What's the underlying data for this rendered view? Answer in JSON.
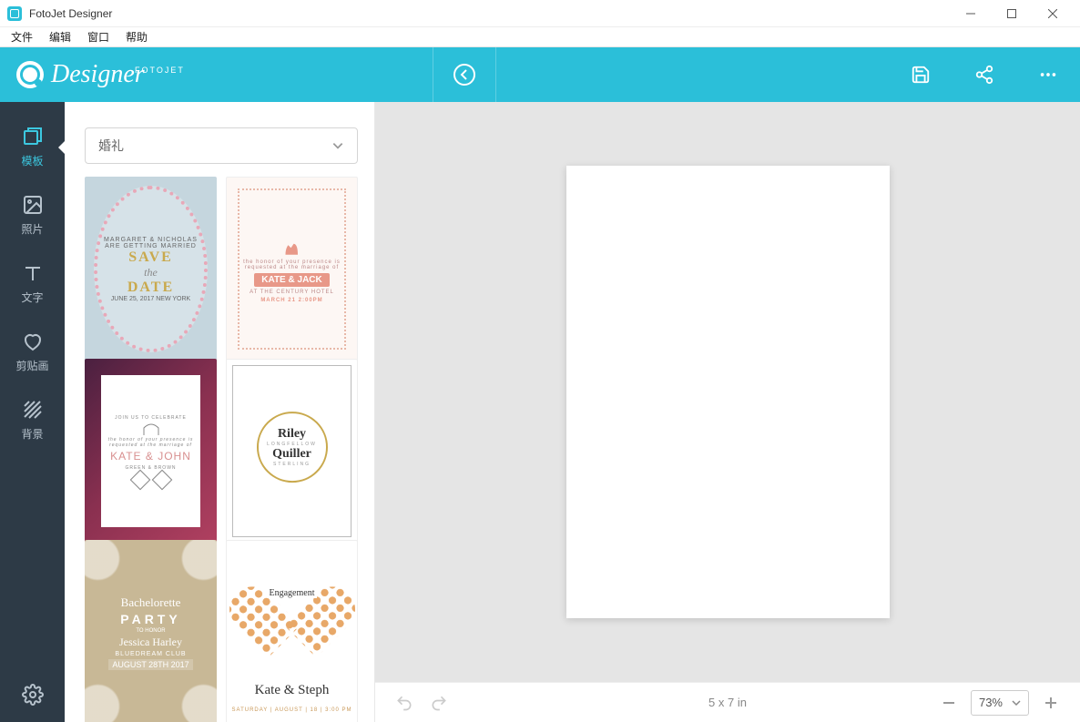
{
  "window": {
    "title": "FotoJet Designer"
  },
  "menu": {
    "file": "文件",
    "edit": "编辑",
    "window": "窗口",
    "help": "帮助"
  },
  "brand": {
    "name": "Designer",
    "sub": "FOTOJET"
  },
  "rail": {
    "templates": "模板",
    "photos": "照片",
    "text": "文字",
    "clipart": "剪贴画",
    "background": "背景"
  },
  "panel": {
    "category": "婚礼",
    "templates": [
      {
        "id": "save-the-date",
        "line1": "SAVE",
        "the": "the",
        "line2": "DATE",
        "sub": "JUNE 25, 2017  NEW YORK"
      },
      {
        "id": "kate-jack",
        "band": "KATE & JACK",
        "date": "MARCH 21 2:00PM",
        "venue": "AT THE CENTURY HOTEL"
      },
      {
        "id": "kate-john",
        "names": "KATE & JOHN",
        "sub": "GREEN   &   BROWN"
      },
      {
        "id": "riley-quiller",
        "n1": "Riley",
        "n2": "Quiller",
        "s1": "LONGFELLOW",
        "s2": "STERLING"
      },
      {
        "id": "bachelorette",
        "bach": "Bachelorette",
        "party": "PARTY",
        "honor": "TO HONOR",
        "name": "Jessica Harley",
        "club": "BLUEDREAM CLUB",
        "date": "AUGUST 28TH 2017"
      },
      {
        "id": "kate-steph",
        "eng": "Engagement",
        "names": "Kate & Steph",
        "bar": "SATURDAY | AUGUST | 18 | 3:00 PM"
      }
    ]
  },
  "canvas": {
    "dimensions": "5 x 7 in"
  },
  "status": {
    "zoom": "73%"
  }
}
